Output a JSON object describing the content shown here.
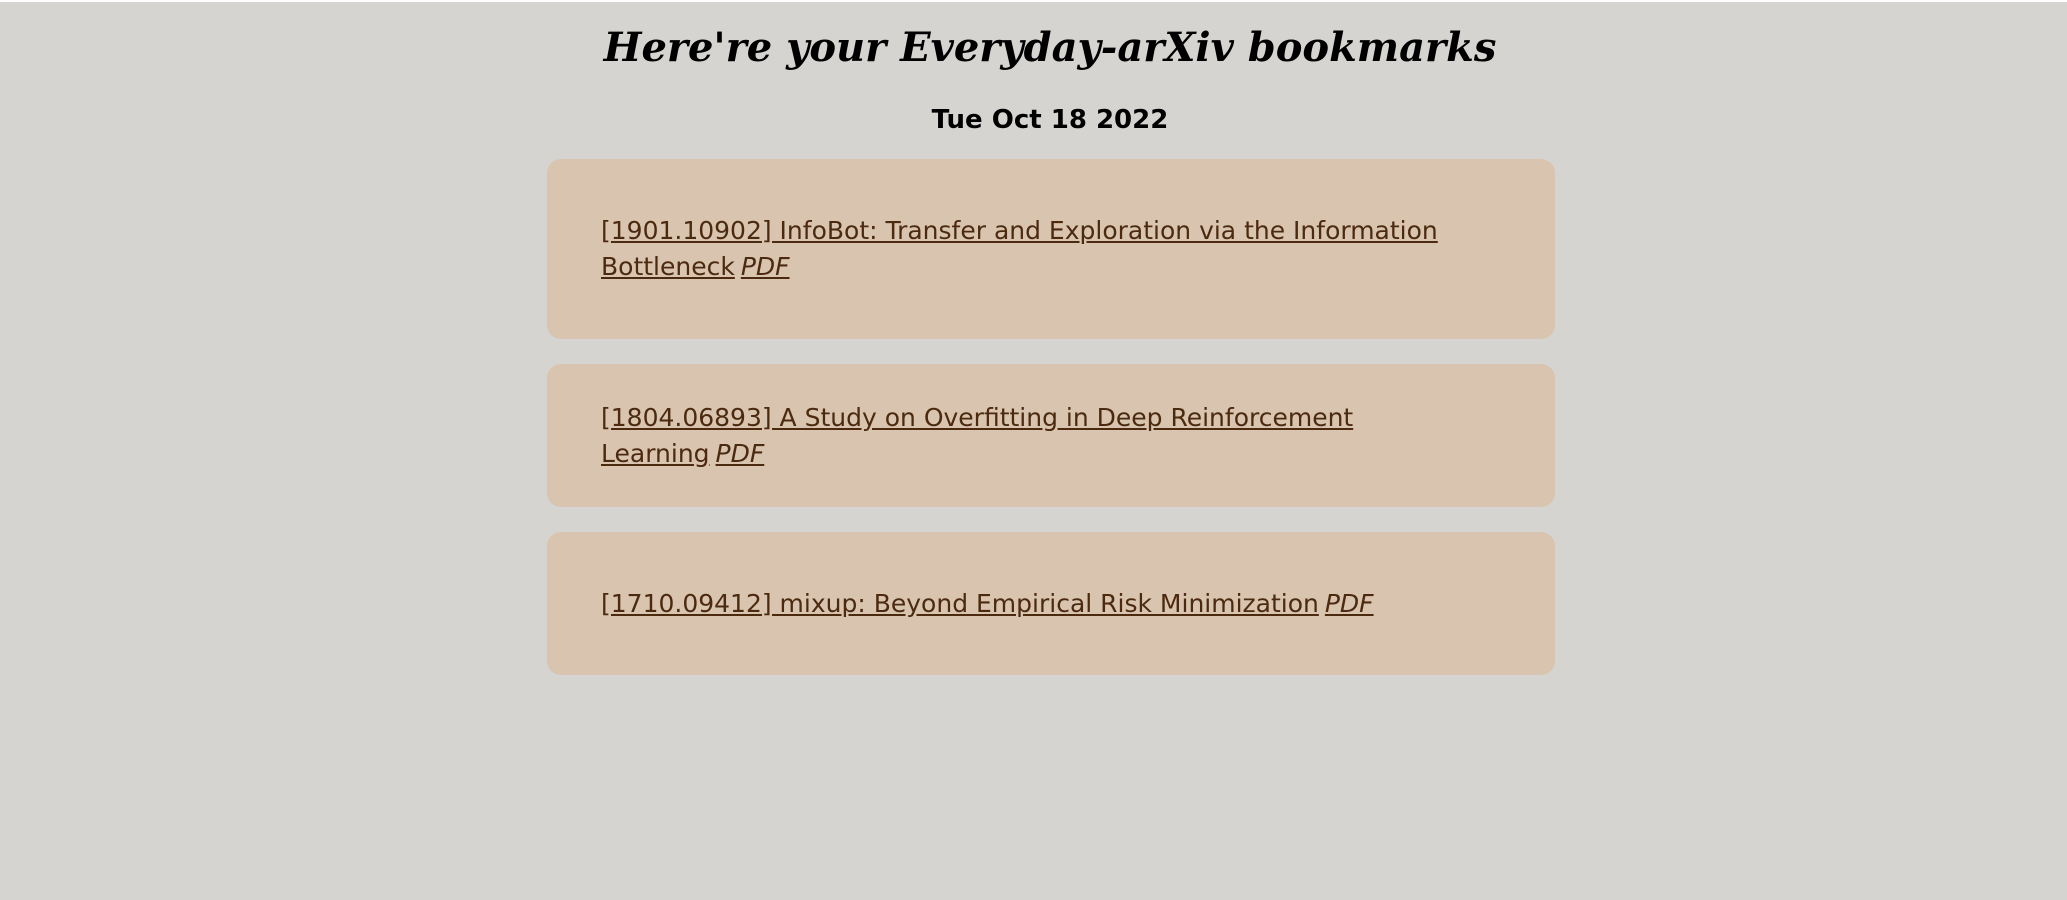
{
  "header": {
    "title": "Here're your Everyday-arXiv bookmarks",
    "date": "Tue Oct 18 2022"
  },
  "bookmarks": [
    {
      "title": "[1901.10902] InfoBot: Transfer and Exploration via the Information Bottleneck",
      "pdf_label": "PDF"
    },
    {
      "title": "[1804.06893] A Study on Overfitting in Deep Reinforcement Learning",
      "pdf_label": "PDF"
    },
    {
      "title": "[1710.09412] mixup: Beyond Empirical Risk Minimization",
      "pdf_label": "PDF"
    }
  ],
  "colors": {
    "page_background": "#d5d4d0",
    "card_background": "#d8c4af",
    "link_text": "#4c2a10",
    "heading_text": "#000000"
  }
}
